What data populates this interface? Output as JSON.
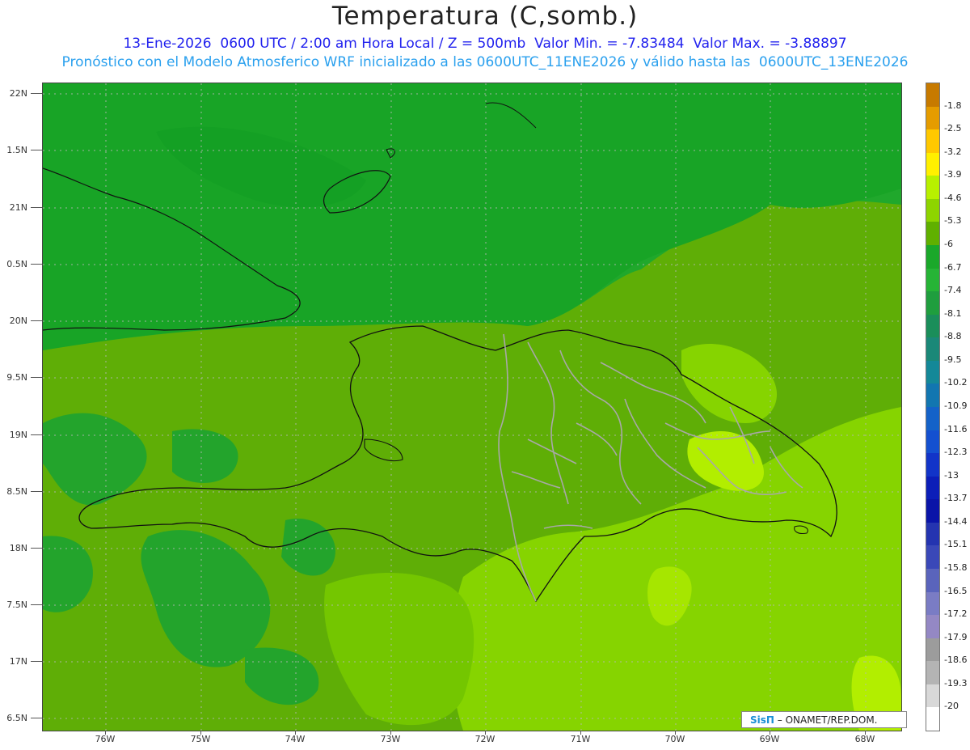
{
  "header": {
    "title": "Temperatura (C,somb.)",
    "line1": "13-Ene-2026  0600 UTC / 2:00 am Hora Local / Z = 500mb  Valor Min. = -7.83484  Valor Max. = -3.88897",
    "line2": "Pronóstico con el Modelo Atmosferico WRF inicializado a las 0600UTC_11ENE2026 y válido hasta las  0600UTC_13ENE2026"
  },
  "axes": {
    "y_labels": [
      "22N",
      "1.5N",
      "21N",
      "0.5N",
      "20N",
      "9.5N",
      "19N",
      "8.5N",
      "18N",
      "7.5N",
      "17N",
      "6.5N"
    ],
    "x_labels": [
      "76W",
      "75W",
      "74W",
      "73W",
      "72W",
      "71W",
      "70W",
      "69W",
      "68W"
    ]
  },
  "colorbar": {
    "labels": [
      "-1.8",
      "-2.5",
      "-3.2",
      "-3.9",
      "-4.6",
      "-5.3",
      "-6",
      "-6.7",
      "-7.4",
      "-8.1",
      "-8.8",
      "-9.5",
      "-10.2",
      "-10.9",
      "-11.6",
      "-12.3",
      "-13",
      "-13.7",
      "-14.4",
      "-15.1",
      "-15.8",
      "-16.5",
      "-17.2",
      "-17.9",
      "-18.6",
      "-19.3",
      "-20"
    ],
    "colors": [
      "#c77a00",
      "#e59c00",
      "#ffc800",
      "#fff000",
      "#b8f000",
      "#8ed400",
      "#60b000",
      "#1aa82a",
      "#26b436",
      "#1f9e3e",
      "#1a8e5a",
      "#1a8878",
      "#148898",
      "#1276b0",
      "#1462c8",
      "#1450d0",
      "#1234c8",
      "#0c1eb8",
      "#0a14a8",
      "#2434b0",
      "#3a48b8",
      "#5a64bc",
      "#7a7cc4",
      "#9488c4",
      "#9c9c9c",
      "#b4b4b4",
      "#d8d8d8",
      "#ffffff"
    ]
  },
  "credit": {
    "logo": "SisΠ",
    "text": "– ONAMET/REP.DOM."
  }
}
